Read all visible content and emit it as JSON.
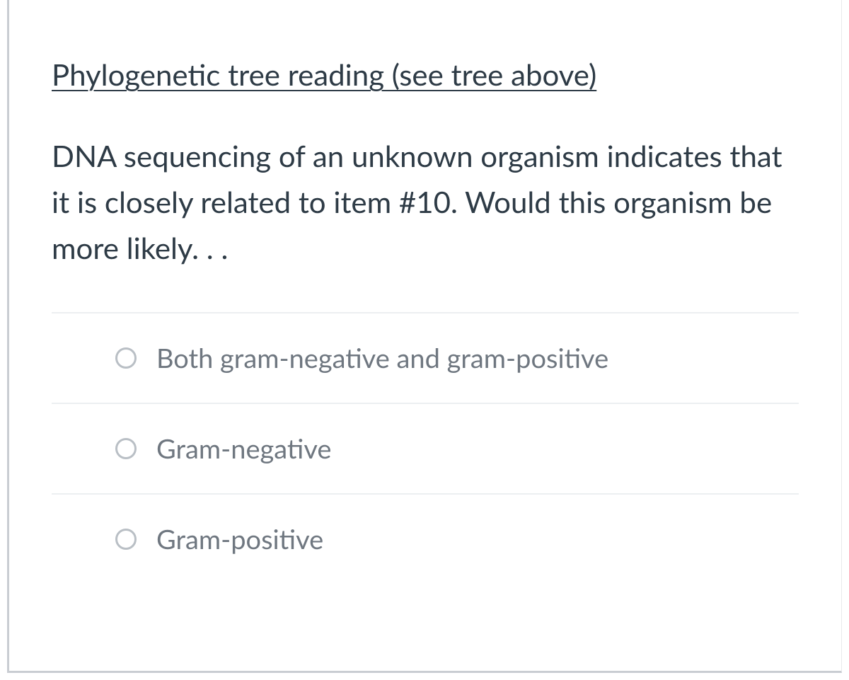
{
  "question": {
    "heading": "Phylogenetic tree reading (see tree above)",
    "body": "DNA sequencing of an unknown organism indicates that it is closely related to item #10.  Would this organism be more likely. . ."
  },
  "options": [
    {
      "label": "Both gram-negative and gram-positive"
    },
    {
      "label": "Gram-negative"
    },
    {
      "label": "Gram-positive"
    }
  ]
}
